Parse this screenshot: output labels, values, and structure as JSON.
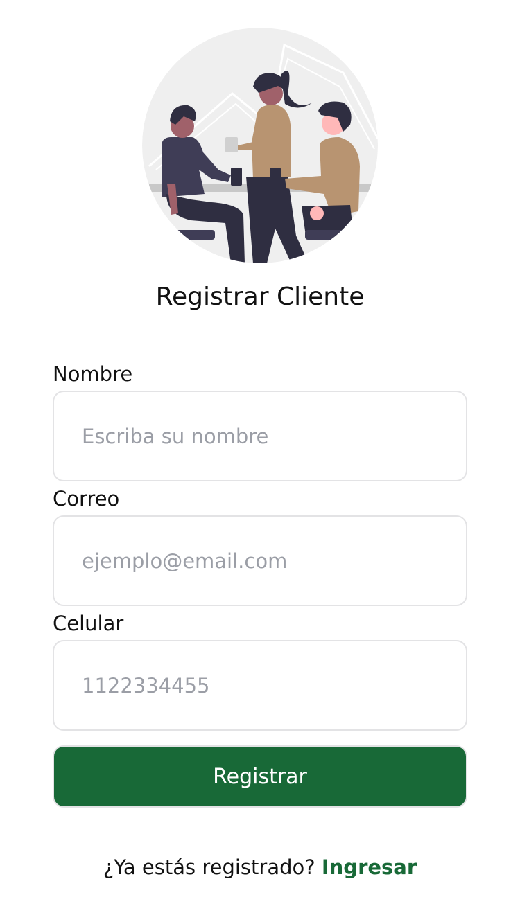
{
  "header": {
    "title": "Registrar Cliente"
  },
  "form": {
    "name": {
      "label": "Nombre",
      "value": "",
      "placeholder": "Escriba su nombre"
    },
    "email": {
      "label": "Correo",
      "value": "",
      "placeholder": "ejemplo@email.com"
    },
    "phone": {
      "label": "Celular",
      "value": "",
      "placeholder": "1122334455"
    },
    "submit_label": "Registrar"
  },
  "footer": {
    "prompt": "¿Ya estás registrado?",
    "login_link": "Ingresar"
  },
  "colors": {
    "primary": "#186937",
    "input_border": "#e3e3e5",
    "placeholder": "#9b9ea6",
    "illustration_bg": "#efefef"
  },
  "icons": {
    "hero": "people-meeting-illustration"
  }
}
